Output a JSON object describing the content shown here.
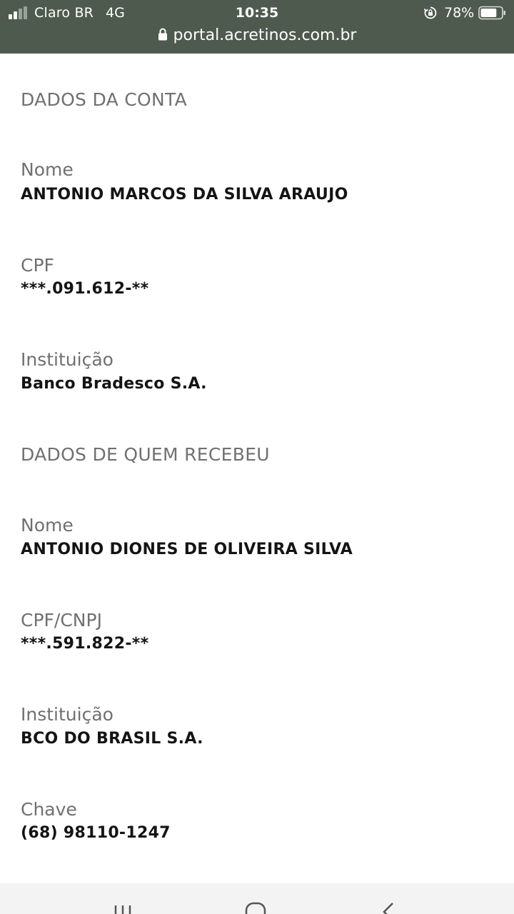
{
  "status_bar": {
    "carrier": "Claro BR",
    "network": "4G",
    "time": "10:35",
    "battery_percent": "78%",
    "battery_level": 0.78,
    "url": "portal.acretinos.com.br"
  },
  "account_section": {
    "title": "DADOS DA CONTA",
    "name_label": "Nome",
    "name_value": "ANTONIO MARCOS DA SILVA ARAUJO",
    "cpf_label": "CPF",
    "cpf_value": "***.091.612-**",
    "institution_label": "Instituição",
    "institution_value": "Banco Bradesco S.A."
  },
  "recipient_section": {
    "title": "DADOS DE QUEM RECEBEU",
    "name_label": "Nome",
    "name_value": "ANTONIO DIONES DE OLIVEIRA SILVA",
    "cpf_label": "CPF/CNPJ",
    "cpf_value": "***.591.822-**",
    "institution_label": "Instituição",
    "institution_value": "BCO DO BRASIL S.A.",
    "key_label": "Chave",
    "key_value": "(68) 98110-1247"
  },
  "nav_bar": {
    "recent_icon": "recent-apps-icon",
    "home_icon": "home-icon",
    "back_icon": "back-icon"
  }
}
